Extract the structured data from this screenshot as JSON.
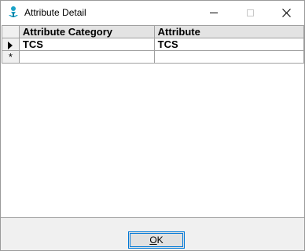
{
  "window": {
    "title": "Attribute Detail",
    "icon": "app-icon",
    "controls": [
      "minimize-icon",
      "maximize-icon",
      "close-icon"
    ]
  },
  "grid": {
    "columns": [
      "Attribute Category",
      "Attribute"
    ],
    "rows": [
      {
        "indicator": "current-row-arrow",
        "cells": [
          "TCS",
          "TCS"
        ]
      }
    ],
    "new_row_indicator": "*"
  },
  "footer": {
    "ok_label_mnemonic": "O",
    "ok_label_rest": "K"
  },
  "colors": {
    "accent": "#0078d7",
    "grid_header": "#e3e3e3",
    "dialog_bg": "#f0f0f0"
  }
}
